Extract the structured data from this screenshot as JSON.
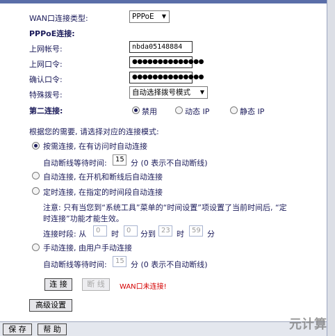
{
  "wan": {
    "type_label": "WAN口连接类型:",
    "type_value": "PPPoE",
    "pppoe_label": "PPPoE连接:"
  },
  "account": {
    "username_label": "上网帐号:",
    "username_value": "nbda05148884",
    "password_label": "上网口令:",
    "password_value": "●●●●●●●●●●●●●●",
    "confirm_label": "确认口令:",
    "confirm_value": "●●●●●●●●●●●●●●",
    "special_label": "特殊拨号:",
    "special_value": "自动选择拨号模式"
  },
  "secondary": {
    "label": "第二连接:",
    "options": [
      "禁用",
      "动态 IP",
      "静态 IP"
    ],
    "selected": 0
  },
  "mode": {
    "intro": "根据您的需要, 请选择对应的连接模式:",
    "ondemand_label": "按需连接, 在有访问时自动连接",
    "ondemand_idle_prefix": "自动断线等待时间:",
    "ondemand_idle_value": "15",
    "ondemand_idle_suffix": "分 (0 表示不自动断线)",
    "auto_label": "自动连接, 在开机和断线后自动连接",
    "timed_label": "定时连接, 在指定的时间段自动连接",
    "timed_note_line1": "注意: 只有当您到“系统工具”菜单的“时间设置”项设置了当前时间后, “定",
    "timed_note_line2": "时连接”功能才能生效。",
    "timed_period_prefix": "连接时段: 从",
    "timed_from_hour": "0",
    "timed_hour_label1": "时",
    "timed_from_min": "0",
    "timed_min_to_label": "分到",
    "timed_to_hour": "23",
    "timed_hour_label2": "时",
    "timed_to_min": "59",
    "timed_min_label": "分",
    "manual_label": "手动连接, 由用户手动连接",
    "manual_idle_prefix": "自动断线等待时间:",
    "manual_idle_value": "15",
    "manual_idle_suffix": "分 (0 表示不自动断线)"
  },
  "actions": {
    "connect": "连 接",
    "disconnect": "断 线",
    "status": "WAN口未连接!",
    "advanced": "高级设置"
  },
  "footer": {
    "save": "保 存",
    "help": "帮 助"
  },
  "watermark": "元计算"
}
